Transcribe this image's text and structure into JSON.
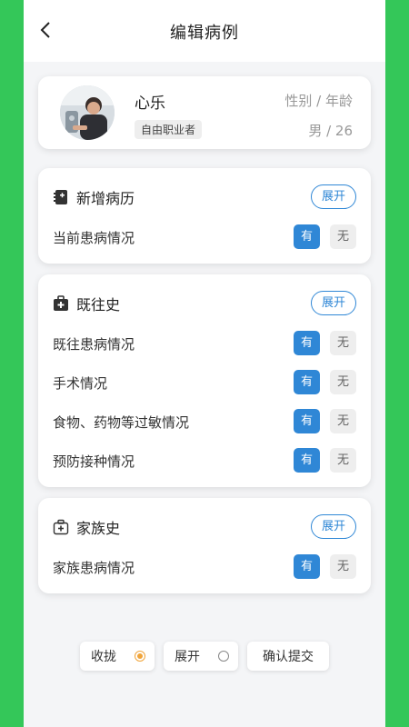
{
  "nav": {
    "title": "编辑病例"
  },
  "profile": {
    "name": "心乐",
    "occupation": "自由职业者",
    "label": "性别 / 年龄",
    "value": "男 / 26"
  },
  "sections": [
    {
      "title": "新增病历",
      "expand": "展开",
      "rows": [
        {
          "label": "当前患病情况",
          "yes": "有",
          "no": "无"
        }
      ]
    },
    {
      "title": "既往史",
      "expand": "展开",
      "rows": [
        {
          "label": "既往患病情况",
          "yes": "有",
          "no": "无"
        },
        {
          "label": "手术情况",
          "yes": "有",
          "no": "无"
        },
        {
          "label": "食物、药物等过敏情况",
          "yes": "有",
          "no": "无"
        },
        {
          "label": "预防接种情况",
          "yes": "有",
          "no": "无"
        }
      ]
    },
    {
      "title": "家族史",
      "expand": "展开",
      "rows": [
        {
          "label": "家族患病情况",
          "yes": "有",
          "no": "无"
        }
      ]
    }
  ],
  "bottom": {
    "collapse": "收拢",
    "expand": "展开",
    "submit": "确认提交",
    "selected": "collapse"
  },
  "colors": {
    "accent": "#2f87d6",
    "radio_selected": "#f0a43a",
    "frame": "#34c759"
  }
}
